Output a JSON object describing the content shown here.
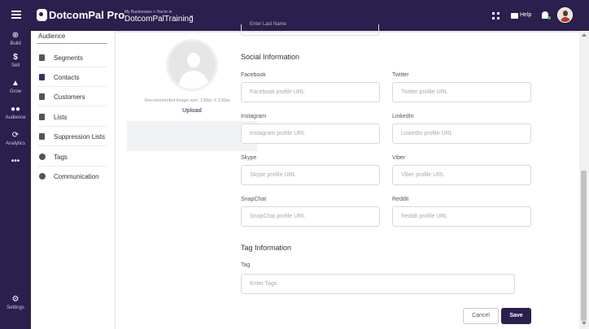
{
  "header": {
    "brand": "DotcomPal Pro",
    "breadcrumb": "My Businesses > You're in",
    "business_name": "DotcomPalTraining",
    "help_label": "Help"
  },
  "rail": {
    "items": [
      {
        "label": "Build",
        "icon": "plus-circle-icon"
      },
      {
        "label": "Sell",
        "icon": "dollar-icon"
      },
      {
        "label": "Grow",
        "icon": "growth-icon"
      },
      {
        "label": "Audience",
        "icon": "people-icon"
      },
      {
        "label": "Analytics",
        "icon": "analytics-icon"
      },
      {
        "label": "",
        "icon": "more-icon"
      }
    ],
    "settings_label": "Settings"
  },
  "subnav": {
    "title": "Audience",
    "items": [
      {
        "label": "Segments",
        "icon": "segments-icon"
      },
      {
        "label": "Contacts",
        "icon": "contacts-icon"
      },
      {
        "label": "Customers",
        "icon": "customers-icon"
      },
      {
        "label": "Lists",
        "icon": "lists-icon"
      },
      {
        "label": "Suppression Lists",
        "icon": "suppression-icon"
      },
      {
        "label": "Tags",
        "icon": "tag-icon"
      },
      {
        "label": "Communication",
        "icon": "communication-icon"
      }
    ]
  },
  "profile": {
    "image_hint": "Recommended image size: 130px X 130px",
    "upload_label": "Upload"
  },
  "previous_field_placeholder": "Enter Last Name",
  "social": {
    "title": "Social Information",
    "fields": [
      {
        "label": "Facebook",
        "placeholder": "Facebook profile URL"
      },
      {
        "label": "Twitter",
        "placeholder": "Twitter profile URL"
      },
      {
        "label": "Instagram",
        "placeholder": "Instagram profile URL"
      },
      {
        "label": "LinkedIn",
        "placeholder": "LinkedIn profile URL"
      },
      {
        "label": "Skype",
        "placeholder": "Skype profile URL"
      },
      {
        "label": "Viber",
        "placeholder": "Viber profile URL"
      },
      {
        "label": "SnapChat",
        "placeholder": "SnapChat profile URL"
      },
      {
        "label": "Reddit",
        "placeholder": "Reddit profile URL"
      }
    ]
  },
  "tags": {
    "title": "Tag Information",
    "label": "Tag",
    "placeholder": "Enter Tags"
  },
  "actions": {
    "cancel": "Cancel",
    "save": "Save"
  },
  "colors": {
    "brand": "#2a1f4d",
    "online": "#4caf50"
  }
}
